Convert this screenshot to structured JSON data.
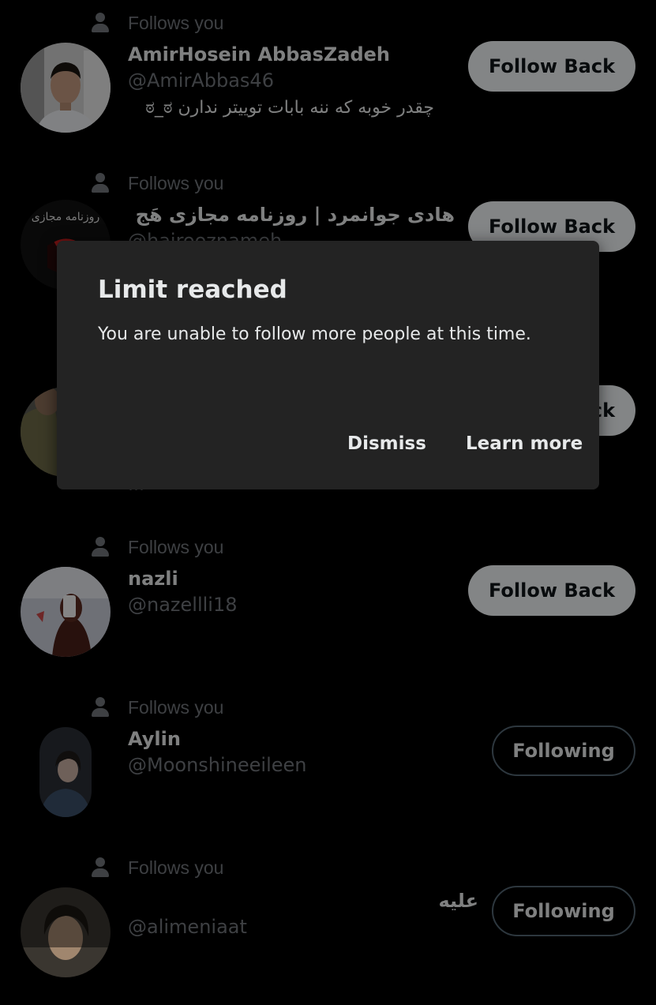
{
  "follows_you_label": "Follows you",
  "rows": [
    {
      "name": "AmirHosein AbbasZadeh",
      "handle": "@AmirAbbas46",
      "bio": "چقدر خوبه که ننه بابات توییتر ندارن ಠ_ಠ",
      "button": "Follow Back",
      "avatar": "portrait-young-man"
    },
    {
      "name": "هادی جوانمرد | روزنامه مجازی هَج",
      "handle": "@hajrooznameh",
      "bio": "",
      "button": "Follow Back",
      "avatar": "logo-rooznameh-majazi"
    },
    {
      "name": "",
      "handle": "",
      "bio": "...",
      "button": "Follow Back",
      "avatar": "person-green-shirt"
    },
    {
      "name": "nazli",
      "handle": "@nazellli18",
      "bio": "",
      "button": "Follow Back",
      "avatar": "selfie-phone"
    },
    {
      "name": "Aylin",
      "handle": "@Moonshineeileen",
      "bio": "",
      "button": "Following",
      "avatar": "portrait-woman-scarf"
    },
    {
      "name": "علیه",
      "handle": "@alimeniaat",
      "bio": "",
      "button": "Following",
      "avatar": "portrait-dark-hair"
    }
  ],
  "avatar_logo_text": "روزنامه مجازی",
  "dialog": {
    "title": "Limit reached",
    "body": "You are unable to follow more people at this time.",
    "dismiss": "Dismiss",
    "learn_more": "Learn more"
  },
  "colors": {
    "background": "#000000",
    "dialog": "#232323",
    "muted": "#71767b",
    "follow_back_bg": "#eff3f4"
  }
}
